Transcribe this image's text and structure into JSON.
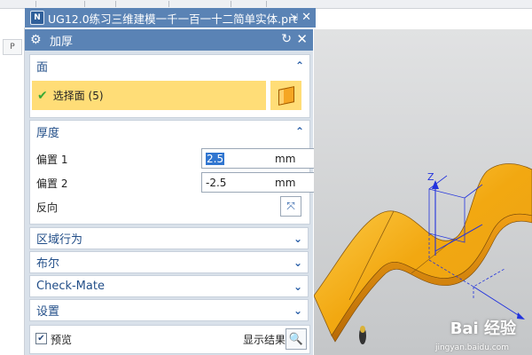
{
  "window": {
    "tab_title": "UG12.0练习三维建模一千一百一十二简单实体.prt",
    "tab_pin_icon": "pin-icon",
    "tab_close_icon": "close-icon",
    "app_icon": "nx-app-icon"
  },
  "leftbar": {
    "cell_text": "P"
  },
  "dialog": {
    "title": "加厚",
    "title_icon": "gear-icon",
    "reset_icon": "reset-icon",
    "close_icon": "close-icon",
    "face_section": {
      "header": "面",
      "select_label": "选择面 (5)",
      "select_icon": "face-cube-icon"
    },
    "thickness_section": {
      "header": "厚度",
      "offset1_label": "偏置 1",
      "offset1_value": "2.5",
      "offset1_unit": "mm",
      "offset2_label": "偏置 2",
      "offset2_value": "-2.5",
      "offset2_unit": "mm",
      "reverse_label": "反向",
      "reverse_icon": "reverse-direction-icon"
    },
    "collapsed_sections": [
      "区域行为",
      "布尔",
      "Check-Mate",
      "设置"
    ],
    "footer": {
      "preview_checked": true,
      "preview_label": "预览",
      "show_result_label": "显示结果",
      "show_result_icon": "magnifier-icon"
    }
  },
  "viewport": {
    "axis_label": "Z",
    "watermark": "Bai 经验",
    "watermark_sub": "jingyan.baidu.com"
  },
  "colors": {
    "title_bar": "#5a83b5",
    "dialog_bg": "#d9e1ea",
    "selection_highlight": "#ffdd77",
    "section_header": "#234f89",
    "solid_body": "#f2b01e",
    "viewport_bg": "#cfd1d3"
  }
}
